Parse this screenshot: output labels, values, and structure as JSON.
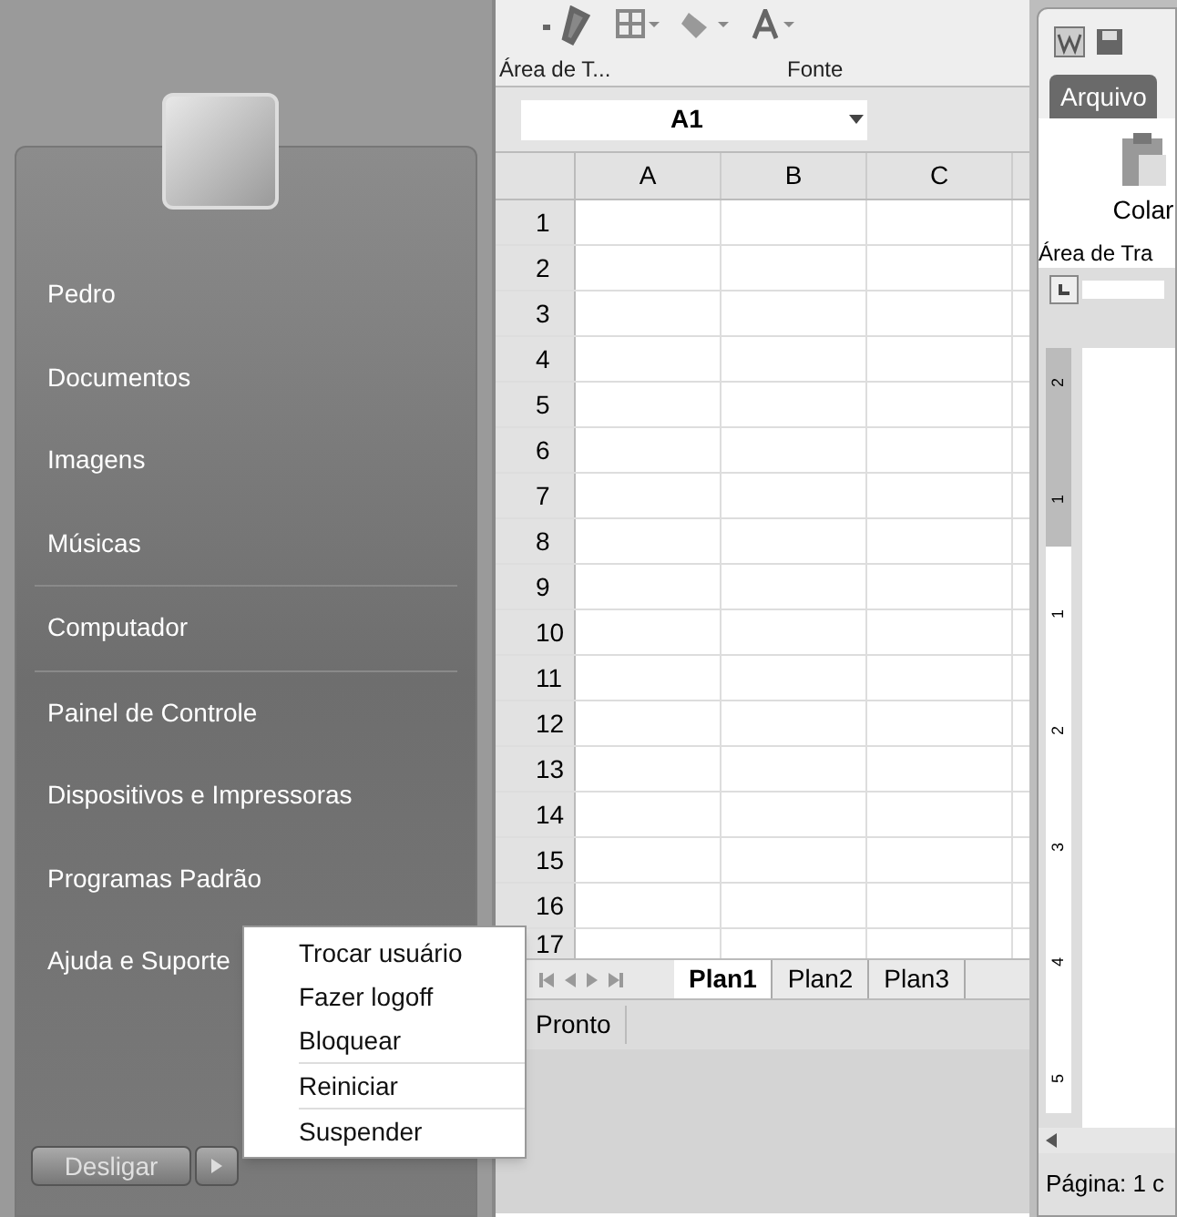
{
  "start_menu": {
    "item_groups": [
      [
        "Pedro",
        "Documentos",
        "Imagens",
        "Músicas"
      ],
      [
        "Computador"
      ],
      [
        "Painel de Controle",
        "Dispositivos e Impressoras",
        "Programas Padrão",
        "Ajuda e Suporte"
      ]
    ],
    "shutdown_button": "Desligar"
  },
  "shutdown_menu": {
    "item_groups": [
      [
        "Trocar usuário",
        "Fazer logoff",
        "Bloquear"
      ],
      [
        "Reiniciar"
      ],
      [
        "Suspender"
      ]
    ]
  },
  "excel": {
    "ribbon_groups": [
      "Área de T...",
      "Fonte"
    ],
    "name_box": "A1",
    "columns": [
      "A",
      "B",
      "C"
    ],
    "rows": [
      "1",
      "2",
      "3",
      "4",
      "5",
      "6",
      "7",
      "8",
      "9",
      "10",
      "11",
      "12",
      "13",
      "14",
      "15",
      "16",
      "17"
    ],
    "sheet_tabs": [
      {
        "label": "Plan1",
        "selected": true
      },
      {
        "label": "Plan2",
        "selected": false
      },
      {
        "label": "Plan3",
        "selected": false
      }
    ],
    "status": "Pronto"
  },
  "word": {
    "file_tab": "Arquivo",
    "paste_button": "Colar",
    "group_label": "Área de Tra",
    "ruler_marks": [
      "2",
      "1",
      "1",
      "2",
      "3",
      "4",
      "5"
    ],
    "status": "Página: 1 c"
  }
}
